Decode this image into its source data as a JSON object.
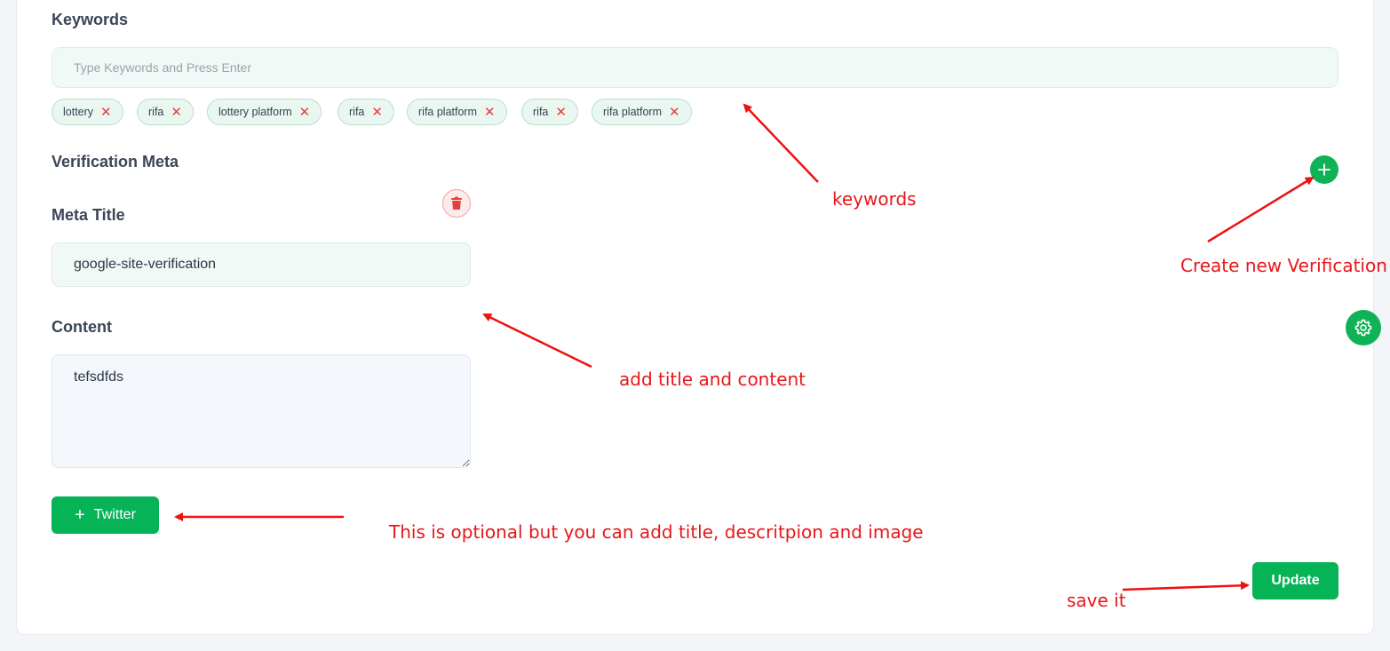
{
  "keywords": {
    "label": "Keywords",
    "placeholder": "Type Keywords and Press Enter",
    "tags": [
      "lottery",
      "rifa",
      "lottery platform",
      "rifa",
      "rifa platform",
      "rifa",
      "rifa platform"
    ],
    "remove_glyph": "✕"
  },
  "verification": {
    "section_label": "Verification Meta",
    "meta_title_label": "Meta Title",
    "meta_title_value": "google-site-verification",
    "content_label": "Content",
    "content_value": "tefsdfds"
  },
  "buttons": {
    "twitter_plus": "+",
    "twitter_label": "Twitter",
    "update_label": "Update",
    "add_icon": "plus-icon",
    "delete_icon": "trash-icon",
    "settings_icon": "gear-icon"
  },
  "annotations": {
    "keywords": "keywords",
    "create_new": "Create new Verification",
    "add_title_content": "add title and content",
    "optional": "This is optional but you can add title, descritpion and image",
    "save": "save it"
  },
  "colors": {
    "accent_green": "#07b357",
    "delete_red": "#e53e3e",
    "annotation_red": "#e8161a"
  }
}
